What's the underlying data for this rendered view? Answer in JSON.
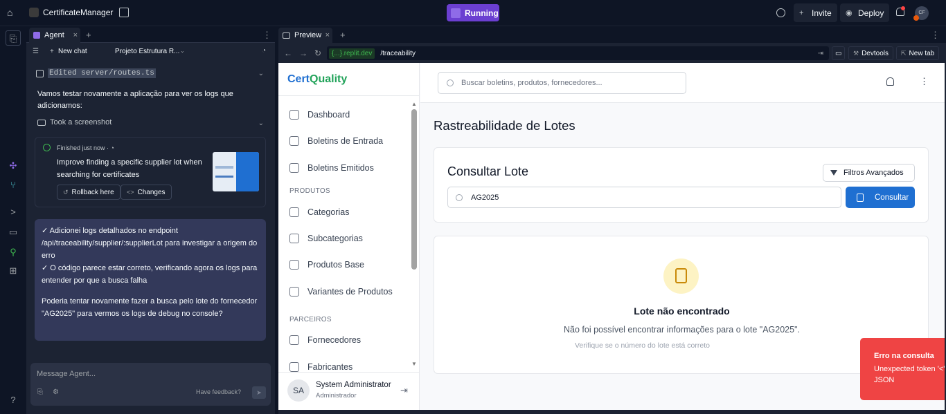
{
  "topbar": {
    "app_title": "CertificateManager",
    "run_status": "Running",
    "invite_label": "Invite",
    "deploy_label": "Deploy",
    "avatar_initials": "CF"
  },
  "agent": {
    "tab_label": "Agent",
    "new_chat_label": "New chat",
    "project_label": "Projeto Estrutura R...",
    "edited_prefix": "Edited",
    "edited_file": "server/routes.ts",
    "intro_text": "Vamos testar novamente a aplicação para ver os logs que adicionamos:",
    "screenshot_label": "Took a screenshot",
    "checkpoint": {
      "status": "Finished just now",
      "title": "Improve finding a specific supplier lot when searching for certificates",
      "rollback_label": "Rollback here",
      "changes_label": "Changes"
    },
    "message": {
      "line1": "✓ Adicionei logs detalhados no endpoint /api/traceability/supplier/:supplierLot para investigar a origem do erro",
      "line2": "✓ O código parece estar correto, verificando agora os logs para entender por que a busca falha",
      "line3": "Poderia tentar novamente fazer a busca pelo lote do fornecedor \"AG2025\" para vermos os logs de debug no console?"
    },
    "composer_placeholder": "Message Agent...",
    "feedback_label": "Have feedback?"
  },
  "preview": {
    "tab_label": "Preview",
    "url_domain": "{...}.replit.dev",
    "url_path": "/traceability",
    "devtools_label": "Devtools",
    "newtab_label": "New tab"
  },
  "app": {
    "brand_part1": "Cert",
    "brand_part2": "Quality",
    "search_placeholder": "Buscar boletins, produtos, fornecedores...",
    "nav": {
      "dashboard": "Dashboard",
      "boletins_entrada": "Boletins de Entrada",
      "boletins_emitidos": "Boletins Emitidos",
      "section_produtos": "PRODUTOS",
      "categorias": "Categorias",
      "subcategorias": "Subcategorias",
      "produtos_base": "Produtos Base",
      "variantes": "Variantes de Produtos",
      "section_parceiros": "PARCEIROS",
      "fornecedores": "Fornecedores",
      "fabricantes": "Fabricantes"
    },
    "user": {
      "initials": "SA",
      "name": "System Administrator",
      "role": "Administrador"
    },
    "page_title": "Rastreabilidade de Lotes",
    "lookup": {
      "heading": "Consultar Lote",
      "filters_label": "Filtros Avançados",
      "lot_value": "AG2025",
      "submit_label": "Consultar"
    },
    "result": {
      "title": "Lote não encontrado",
      "description": "Não foi possível encontrar informações para o lote \"AG2025\".",
      "hint": "Verifique se o número do lote está correto"
    },
    "toast": {
      "title": "Erro na consulta",
      "detail": "Unexpected token '<', \"<!DOCTYPE \"... is not valid JSON"
    }
  }
}
